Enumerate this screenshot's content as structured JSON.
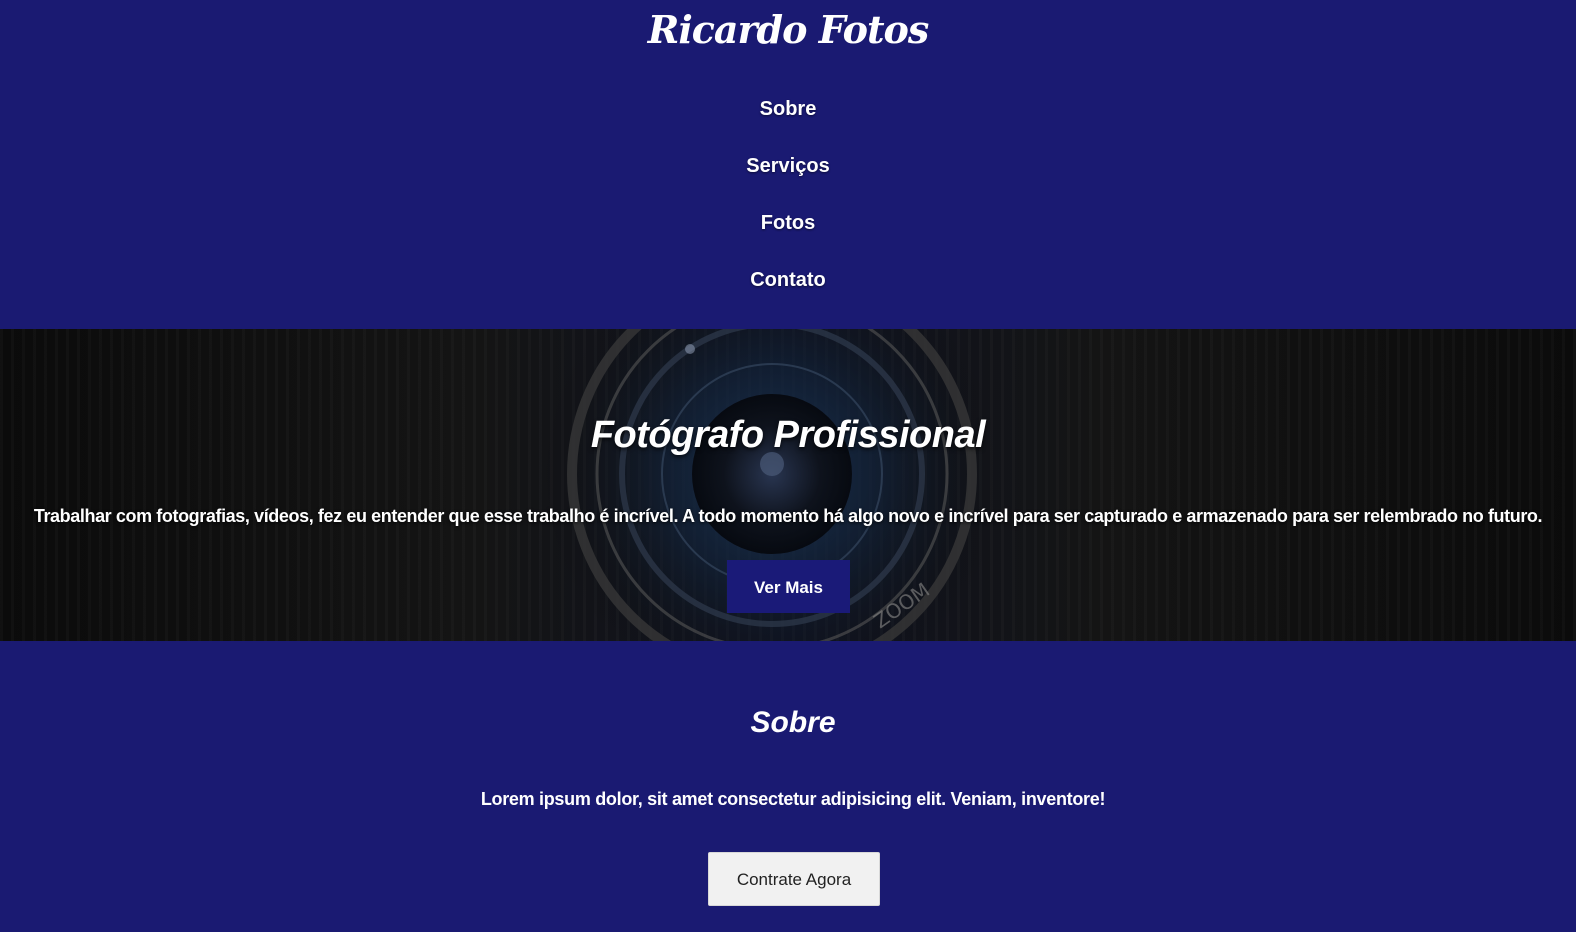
{
  "header": {
    "logo": "Ricardo Fotos",
    "nav": [
      {
        "label": "Sobre"
      },
      {
        "label": "Serviços"
      },
      {
        "label": "Fotos"
      },
      {
        "label": "Contato"
      }
    ]
  },
  "hero": {
    "title": "Fotógrafo Profissional",
    "text": "Trabalhar com fotografias, vídeos, fez eu entender que esse trabalho é incrível. A todo momento há algo novo e incrível para ser capturado e armazenado para ser relembrado no futuro.",
    "button_label": "Ver Mais",
    "lens_text": "ZOOM"
  },
  "sobre": {
    "title": "Sobre",
    "text": "Lorem ipsum dolor, sit amet consectetur adipisicing elit. Veniam, inventore!",
    "button_label": "Contrate Agora"
  },
  "colors": {
    "primary": "#1a1a72",
    "hero_bg": "#111111",
    "button_light": "#f1f1f1",
    "text": "#ffffff"
  }
}
